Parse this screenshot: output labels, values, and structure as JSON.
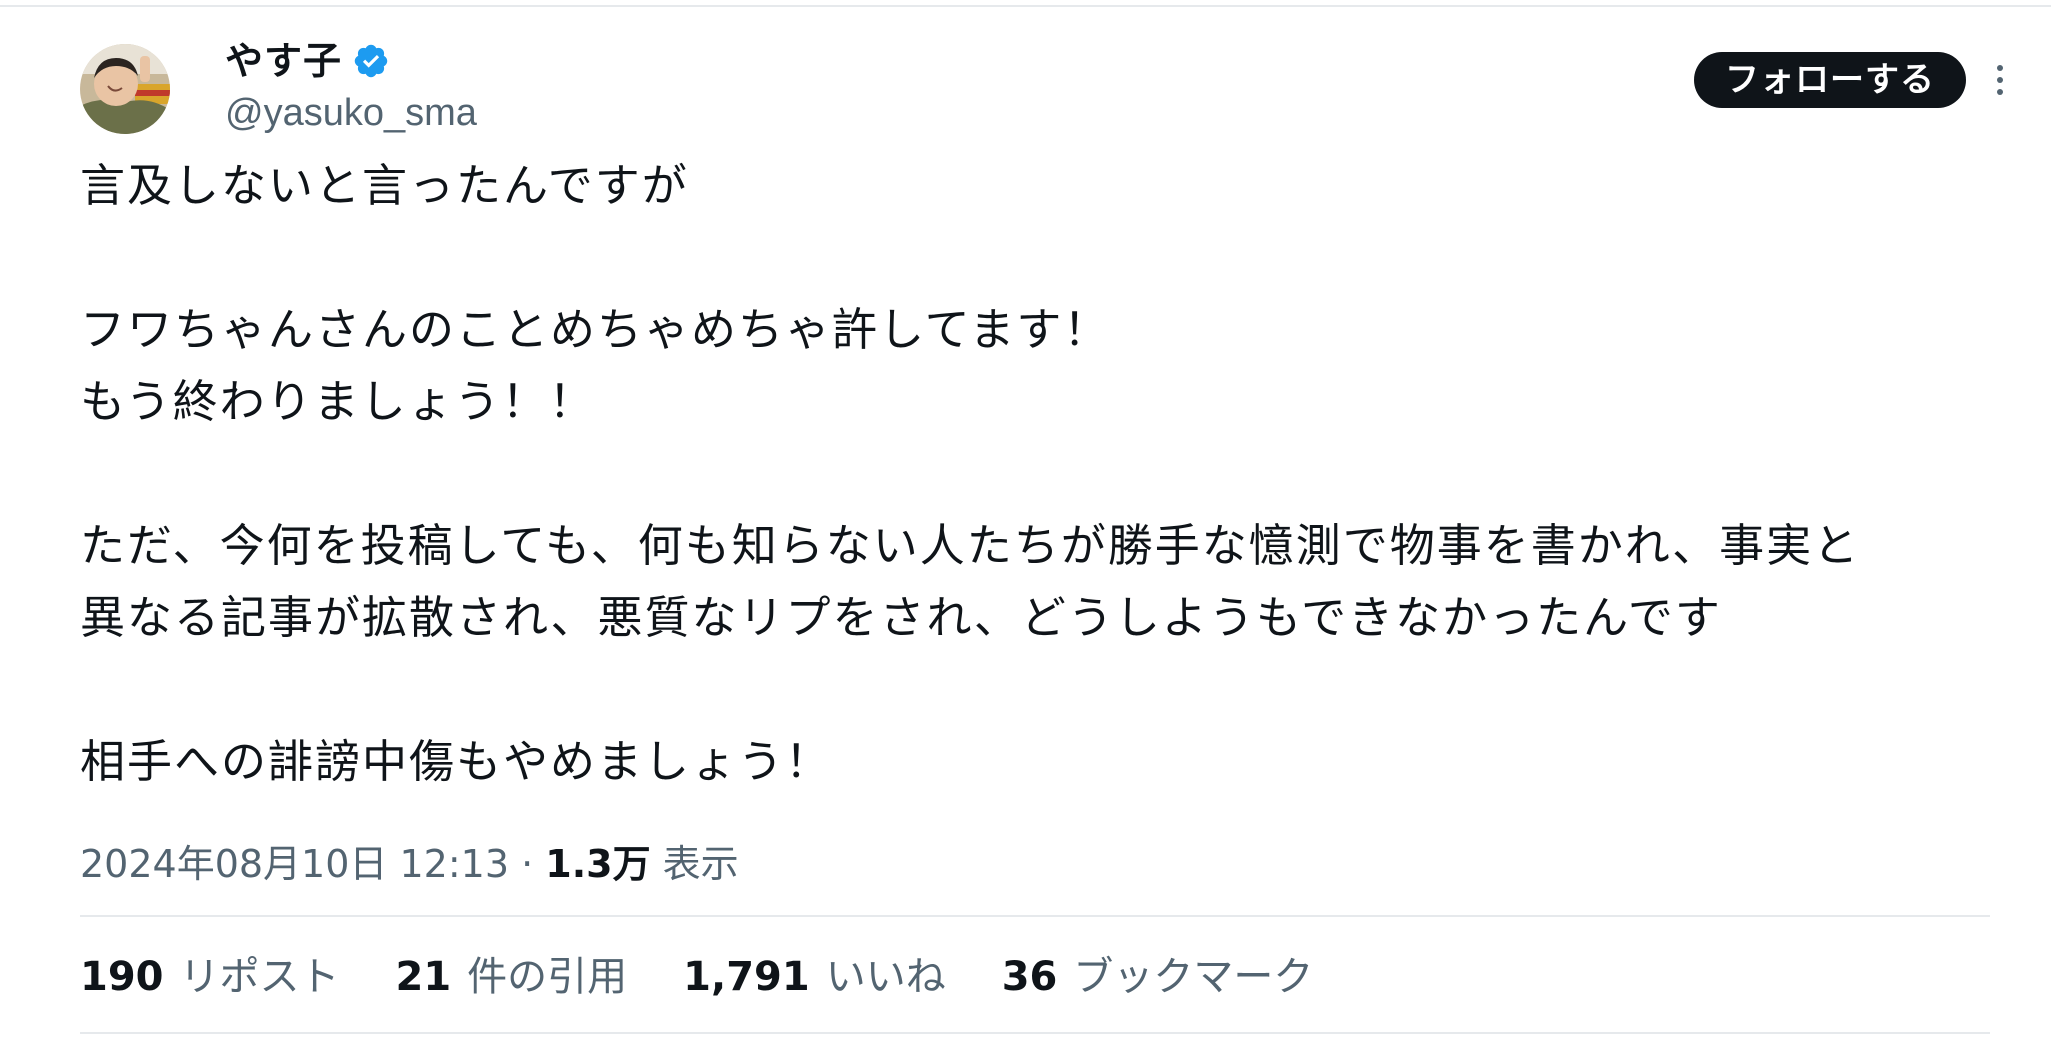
{
  "author": {
    "display_name": "やす子",
    "handle": "@yasuko_sma",
    "verified_icon": "verified-badge-icon",
    "avatar_icon": "avatar-photo"
  },
  "actions": {
    "follow_label": "フォローする",
    "more_icon": "more-options-icon"
  },
  "tweet": {
    "lines": [
      "言及しないと言ったんですが",
      "フワちゃんさんのことめちゃめちゃ許してます！",
      "もう終わりましょう！！",
      "ただ、今何を投稿しても、何も知らない人たちが勝手な憶測で物事を書かれ、事実と",
      "異なる記事が拡散され、悪質なリプをされ、どうしようもできなかったんです",
      "相手への誹謗中傷もやめましょう！"
    ]
  },
  "meta": {
    "timestamp": "2024年08月10日 12:13",
    "separator": " · ",
    "views_count": "1.3万",
    "views_label": " 表示"
  },
  "stats": [
    {
      "count": "190",
      "label": "リポスト"
    },
    {
      "count": "21",
      "label": "件の引用"
    },
    {
      "count": "1,791",
      "label": "いいね"
    },
    {
      "count": "36",
      "label": "ブックマーク"
    }
  ],
  "colors": {
    "text_primary": "#0f1419",
    "text_secondary": "#536471",
    "verified_blue": "#1d9bf0",
    "divider": "#e6e9ec",
    "button_bg": "#0f1419"
  }
}
